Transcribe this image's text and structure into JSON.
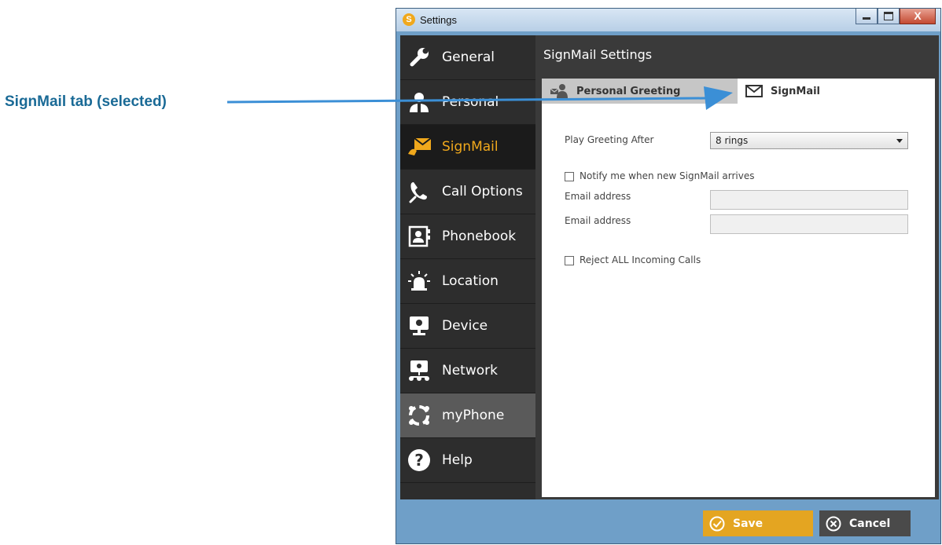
{
  "annotation": {
    "callout_text": "SignMail tab (selected)"
  },
  "window": {
    "title": "Settings",
    "close_glyph": "X"
  },
  "sidebar": {
    "items": [
      {
        "label": "General",
        "icon": "wrench-icon"
      },
      {
        "label": "Personal",
        "icon": "person-icon"
      },
      {
        "label": "SignMail",
        "icon": "signmail-icon",
        "selected": true
      },
      {
        "label": "Call Options",
        "icon": "phone-wrench-icon"
      },
      {
        "label": "Phonebook",
        "icon": "phonebook-icon"
      },
      {
        "label": "Location",
        "icon": "siren-icon"
      },
      {
        "label": "Device",
        "icon": "webcam-icon"
      },
      {
        "label": "Network",
        "icon": "network-icon"
      },
      {
        "label": "myPhone",
        "icon": "myphone-ring-icon"
      },
      {
        "label": "Help",
        "icon": "help-icon"
      }
    ]
  },
  "main": {
    "title": "SignMail Settings",
    "tabs": [
      {
        "label": "Personal Greeting",
        "icon": "greeting-icon",
        "selected": false
      },
      {
        "label": "SignMail",
        "icon": "envelope-icon",
        "selected": true
      }
    ],
    "play_greeting": {
      "label": "Play Greeting After",
      "value": "8 rings"
    },
    "notify": {
      "label": "Notify me when new SignMail arrives",
      "checked": false
    },
    "email_fields": [
      {
        "label": "Email address",
        "value": ""
      },
      {
        "label": "Email address",
        "value": ""
      }
    ],
    "reject": {
      "label": "Reject ALL Incoming Calls",
      "checked": false
    }
  },
  "footer": {
    "save_label": "Save",
    "cancel_label": "Cancel"
  },
  "colors": {
    "accent": "#f0a81c",
    "save_button": "#e4a521",
    "callout": "#1a6a96",
    "arrow": "#3b8fd6"
  }
}
